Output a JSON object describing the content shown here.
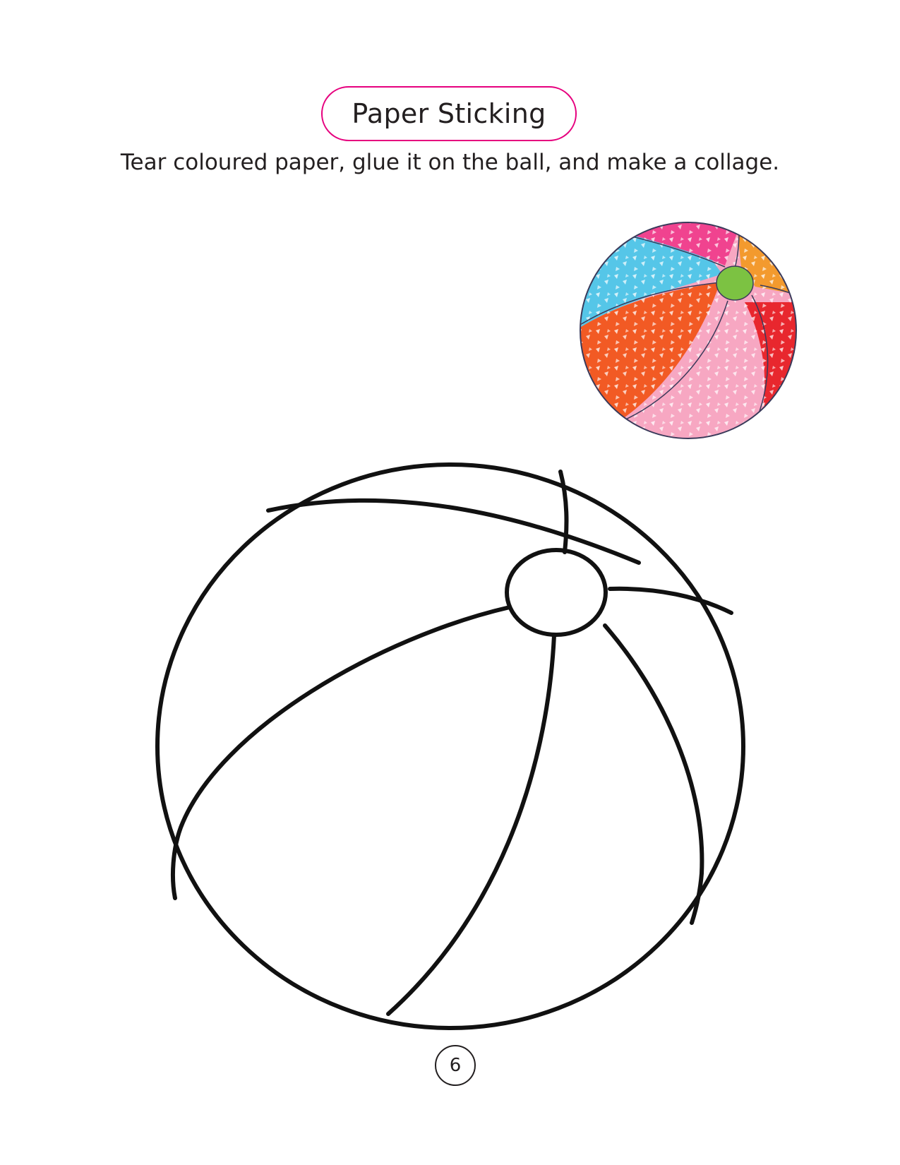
{
  "heading": {
    "title": "Paper Sticking",
    "accent_color": "#e6007e"
  },
  "instruction": "Tear coloured paper, glue it on the ball, and make a collage.",
  "example_ball": {
    "icon": "collage-beach-ball",
    "panel_colors": [
      "#f0438f",
      "#f39a2e",
      "#7cc242",
      "#e8272e",
      "#f7a7c2",
      "#f25a24",
      "#55c6e8"
    ]
  },
  "outline_ball": {
    "icon": "beach-ball-outline"
  },
  "footer": {
    "page_number": "6"
  }
}
